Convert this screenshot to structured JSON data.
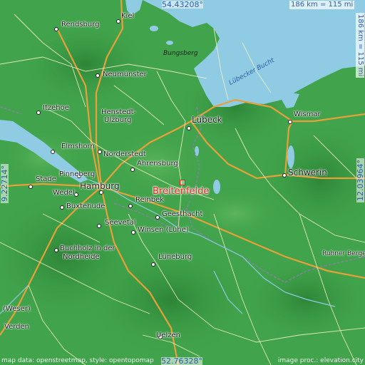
{
  "map": {
    "target": {
      "name": "Breitenfelde"
    },
    "coordinates": {
      "north": "54.43208°",
      "south": "52.76328°",
      "west": "9.22714°",
      "east": "12.03964°"
    },
    "scale": {
      "horizontal": "186 km = 115 mi",
      "vertical": "186 km = 115 mi"
    },
    "cities": {
      "kiel": "Kiel",
      "rendsburg": "Rendsburg",
      "neumunster": "Neumünster",
      "itzehoe": "Itzehoe",
      "henstedt": "Henstedt-",
      "ulzburg": "Ulzburg",
      "elmshorn": "Elmshorn",
      "norderstedt": "Norderstedt",
      "ahrensburg": "Ahrensburg",
      "pinneberg": "Pinneberg",
      "stade": "Stade",
      "wedel": "Wedel",
      "hamburg": "Hamburg",
      "buxtehude": "Buxtehude",
      "reinbek": "Reinbek",
      "geesthacht": "Geesthacht",
      "seevetal": "Seevetal",
      "winsen": "Winsen (Luhe)",
      "buchholz1": "Buchholz in der",
      "buchholz2": "Nordheide",
      "luneburg": "Lüneburg",
      "uelzen": "Uelzen",
      "lubeck": "Lübeck",
      "wismar": "Wismar",
      "schwerin": "Schwerin",
      "ruhner": "Ruhner Berge",
      "weser": "(Weser)",
      "verden": "Verden"
    },
    "water": {
      "bay": "Lübecker Bucht"
    },
    "hills": {
      "bungsberg": "Bungsberg"
    },
    "credits": {
      "left": "map data: openstreetmap, style: opentopomap",
      "right": "image proc.: elevation.city"
    },
    "colors": {
      "sea": "#8fcbe3",
      "lowland": "#3fa24a",
      "highland": "#2f8a3a",
      "motorway": "#e8a03a",
      "road": "#f4f0c8",
      "border": "#8a7fa8",
      "target": "#e0281f",
      "coord_text": "#2c5ea8"
    }
  }
}
